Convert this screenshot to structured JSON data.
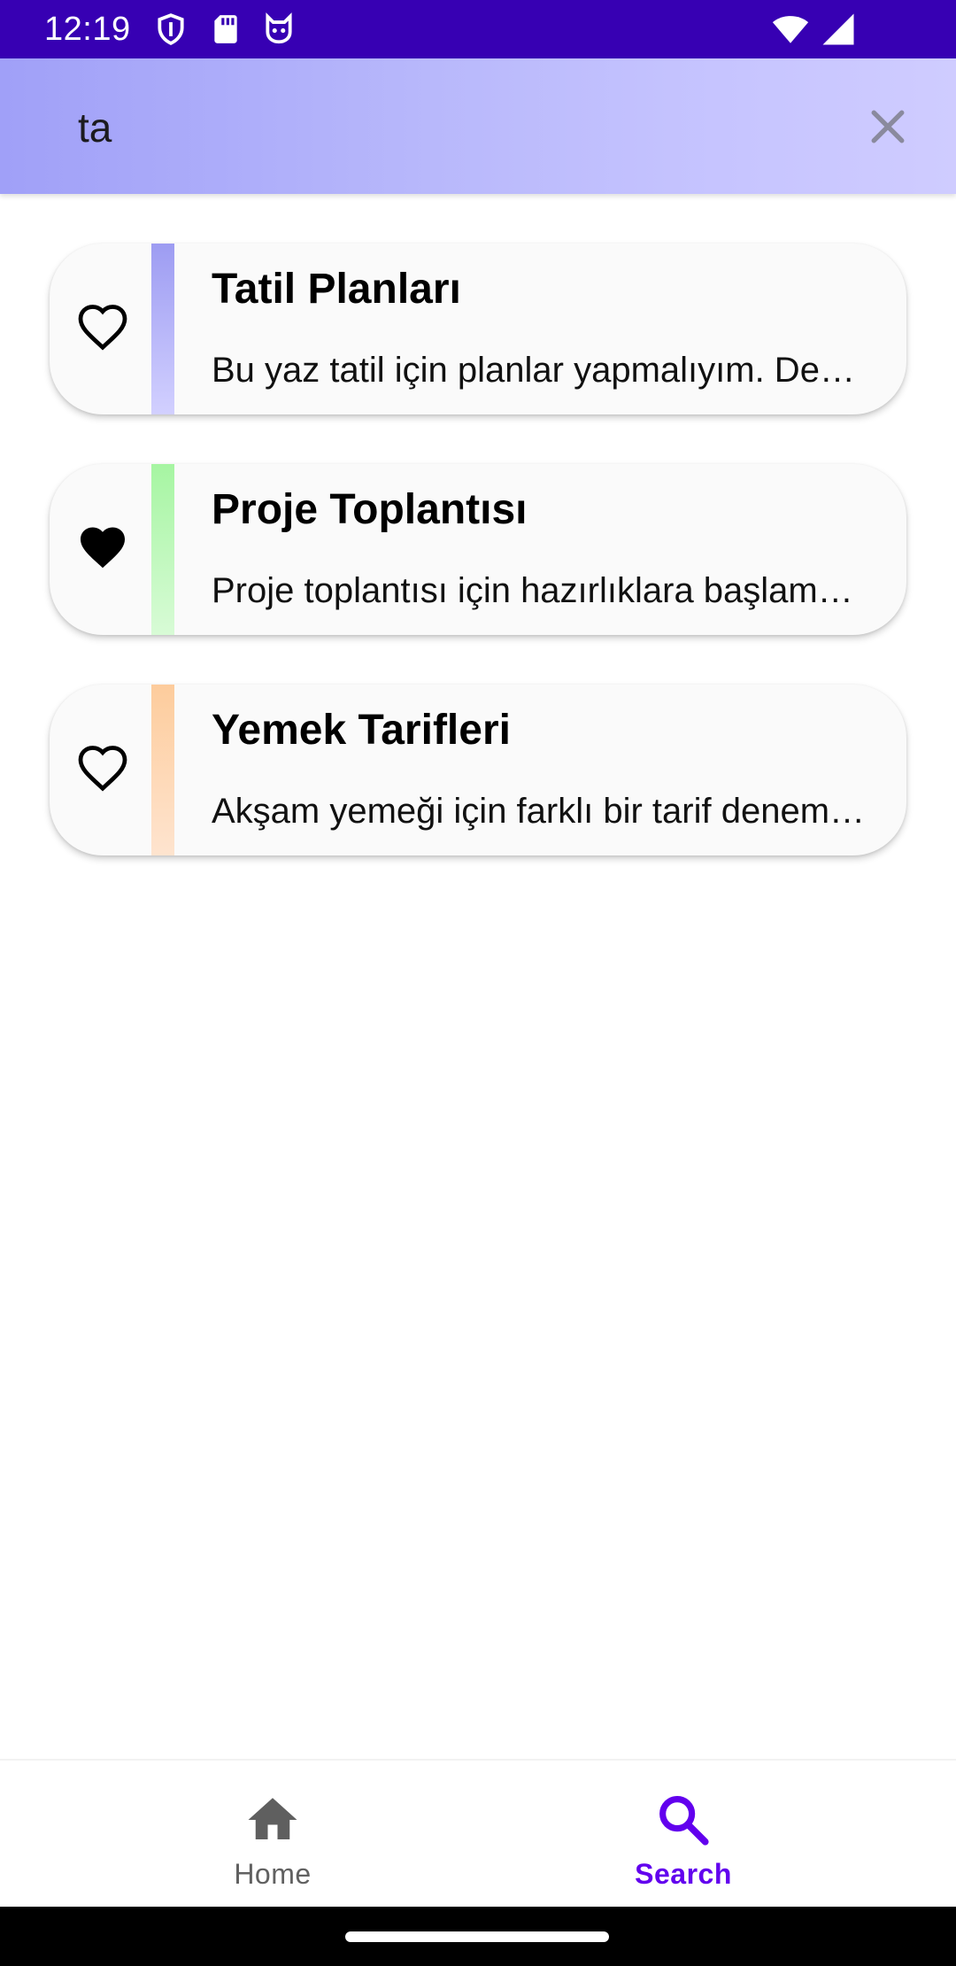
{
  "status_bar": {
    "time": "12:19",
    "left_icons": [
      "shield-icon",
      "sd-card-icon",
      "cat-face-icon"
    ],
    "right_icons": [
      "wifi-icon",
      "cellular-signal-icon"
    ]
  },
  "search": {
    "query": "ta",
    "clear_icon": "close-icon"
  },
  "notes": [
    {
      "title": "Tatil Planları",
      "body": "Bu yaz tatil için planlar yapmalıyım. Deniz kenarında bir otel",
      "favorite": false,
      "strip_colors": [
        "#9d9cf2",
        "#d2d0ff"
      ]
    },
    {
      "title": "Proje Toplantısı",
      "body": "Proje toplantısı için hazırlıklara başlamam gerekiyor",
      "favorite": true,
      "strip_colors": [
        "#a6f5a2",
        "#d8fbd6"
      ]
    },
    {
      "title": "Yemek Tarifleri",
      "body": "Akşam yemeği için farklı bir tarif denemek istiyorum",
      "favorite": false,
      "strip_colors": [
        "#fdcc9c",
        "#fee4cf"
      ]
    }
  ],
  "bottom_nav": {
    "home_label": "Home",
    "search_label": "Search",
    "active": "Search",
    "active_color": "#6200ee",
    "inactive_color": "#616161"
  }
}
